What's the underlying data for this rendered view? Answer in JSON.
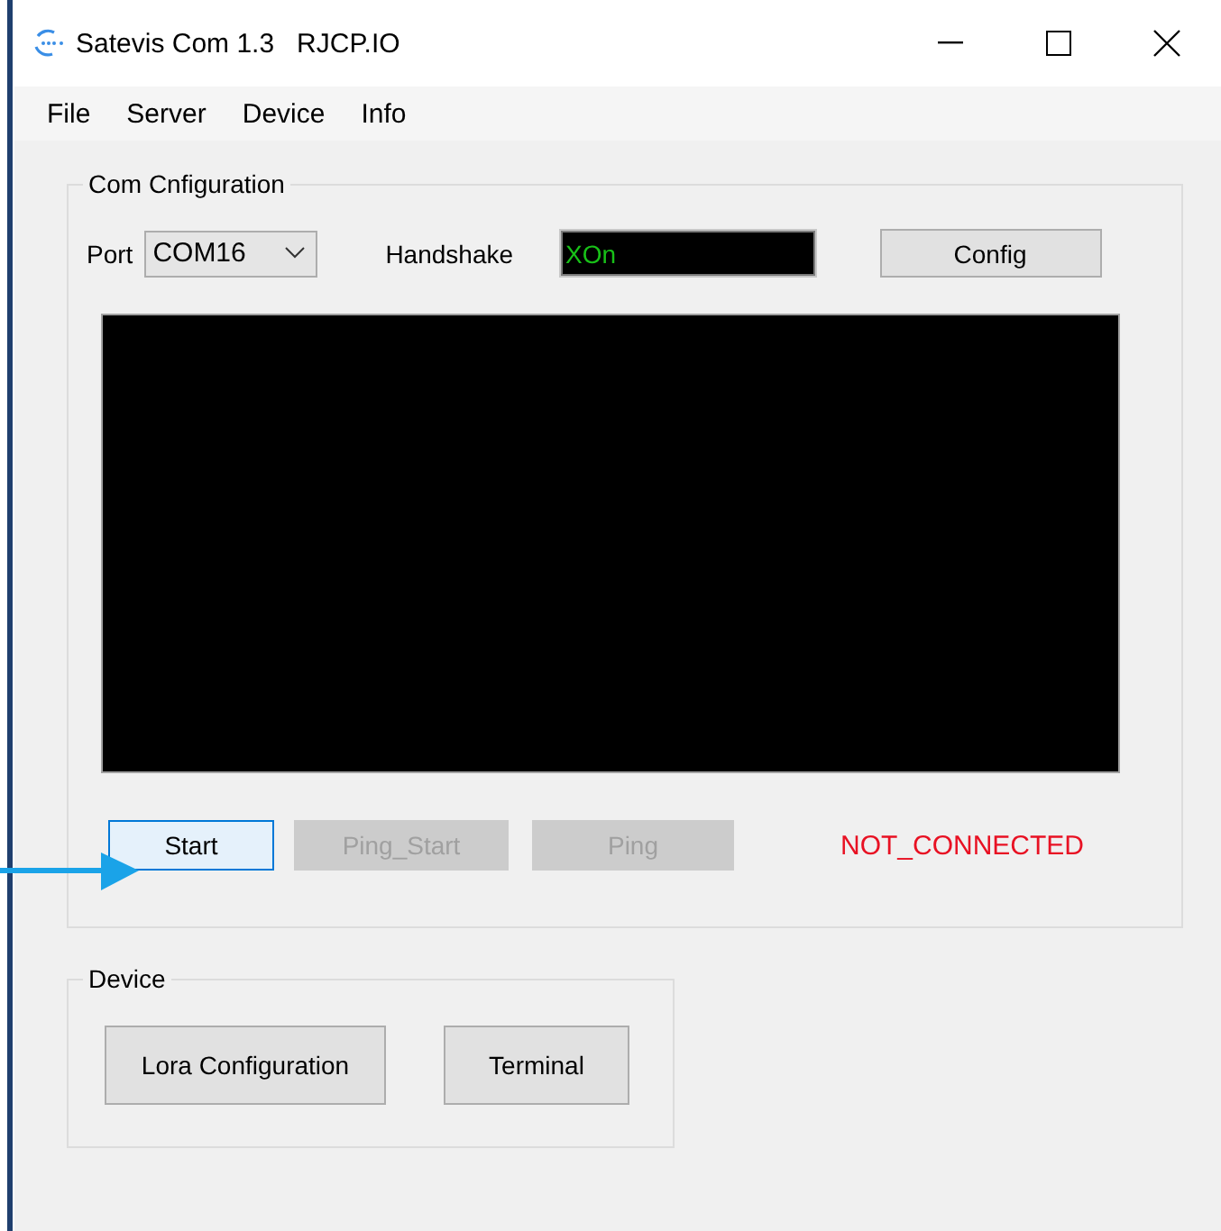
{
  "window": {
    "title": "Satevis Com 1.3   RJCP.IO"
  },
  "menu": [
    "File",
    "Server",
    "Device",
    "Info"
  ],
  "com_configuration": {
    "title": "Com Cnfiguration",
    "port_label": "Port",
    "port_value": "COM16",
    "handshake_label": "Handshake",
    "handshake_value": "XOn",
    "config_button": "Config",
    "buttons": [
      {
        "label": "Start",
        "disabled": false,
        "focused": true
      },
      {
        "label": "Ping_Start",
        "disabled": true,
        "focused": false
      },
      {
        "label": "Ping",
        "disabled": true,
        "focused": false
      }
    ],
    "status": "NOT_CONNECTED"
  },
  "device": {
    "title": "Device",
    "buttons": [
      "Lora Configuration",
      "Terminal"
    ]
  }
}
